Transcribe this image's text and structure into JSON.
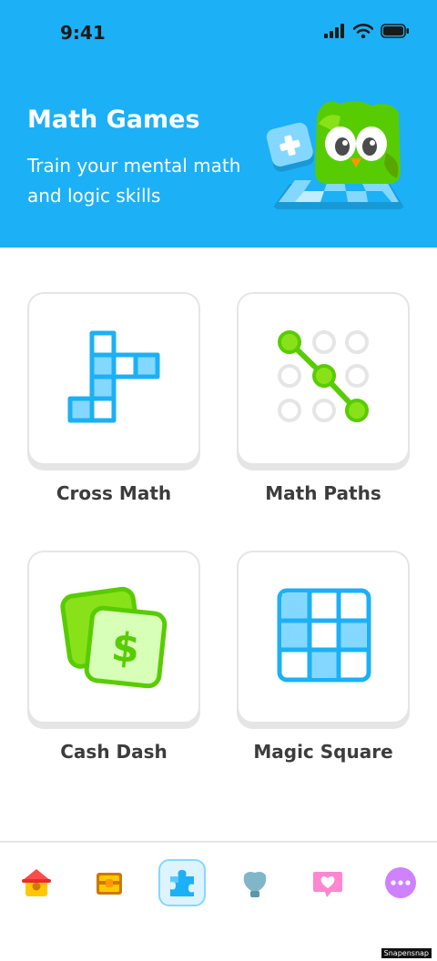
{
  "status_bar": {
    "time": "9:41"
  },
  "hero": {
    "title": "Math Games",
    "subtitle": "Train your mental math and logic skills"
  },
  "games": [
    {
      "label": "Cross Math",
      "icon": "cross-math-icon"
    },
    {
      "label": "Math Paths",
      "icon": "math-paths-icon"
    },
    {
      "label": "Cash Dash",
      "icon": "cash-dash-icon"
    },
    {
      "label": "Magic Square",
      "icon": "magic-square-icon"
    }
  ],
  "bottom_nav": {
    "items": [
      {
        "icon": "home-icon"
      },
      {
        "icon": "treasure-chest-icon"
      },
      {
        "icon": "puzzle-piece-icon",
        "active": true
      },
      {
        "icon": "shield-icon"
      },
      {
        "icon": "heart-message-icon"
      },
      {
        "icon": "more-icon"
      }
    ]
  },
  "watermark": "Snapensnap",
  "colors": {
    "brand_blue": "#1CB0F6",
    "brand_green": "#58CC02",
    "card_border": "#e5e5e5",
    "label_text": "#3c3c3c"
  }
}
